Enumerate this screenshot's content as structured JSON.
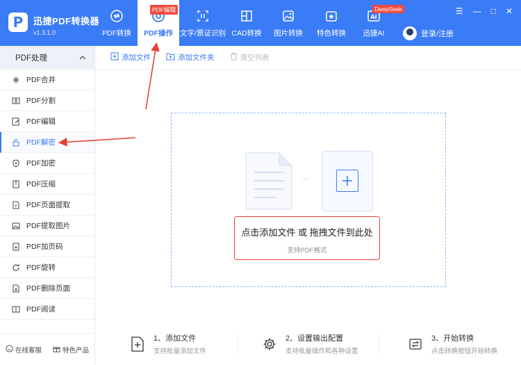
{
  "app": {
    "name": "迅捷PDF转换器",
    "version": "v1.3.1.0",
    "brand_color": "#3a7bf6"
  },
  "nav": [
    {
      "label": "PDF转换",
      "icon": "convert-icon"
    },
    {
      "label": "PDF操作",
      "icon": "pdf-operate-icon",
      "badge": "PDF编辑",
      "active": true
    },
    {
      "label": "文字/票证识别",
      "icon": "ocr-icon"
    },
    {
      "label": "CAD转换",
      "icon": "cad-icon"
    },
    {
      "label": "图片转换",
      "icon": "image-icon"
    },
    {
      "label": "特色转换",
      "icon": "star-icon"
    },
    {
      "label": "迅捷AI",
      "icon": "ai-icon",
      "badge": "DeepSeek"
    }
  ],
  "user": {
    "login_label": "登录/注册"
  },
  "sidebar": {
    "header": "PDF处理",
    "items": [
      {
        "label": "PDF合并",
        "icon": "merge-icon"
      },
      {
        "label": "PDF分割",
        "icon": "split-icon"
      },
      {
        "label": "PDF编辑",
        "icon": "edit-icon"
      },
      {
        "label": "PDF解密",
        "icon": "unlock-icon",
        "active": true
      },
      {
        "label": "PDF加密",
        "icon": "shield-icon"
      },
      {
        "label": "PDF压缩",
        "icon": "compress-icon"
      },
      {
        "label": "PDF页面提取",
        "icon": "extract-page-icon"
      },
      {
        "label": "PDF提取图片",
        "icon": "extract-image-icon"
      },
      {
        "label": "PDF加页码",
        "icon": "page-number-icon"
      },
      {
        "label": "PDF旋转",
        "icon": "rotate-icon"
      },
      {
        "label": "PDF删除页面",
        "icon": "delete-page-icon"
      },
      {
        "label": "PDF阅读",
        "icon": "read-icon"
      }
    ],
    "footer": {
      "service": "在线客服",
      "featured": "特色产品"
    }
  },
  "toolbar": {
    "add_file": "添加文件",
    "add_folder": "添加文件夹",
    "clear_list": "清空列表"
  },
  "dropzone": {
    "main": "点击添加文件 或 拖拽文件到此处",
    "sub": "支持PDF格式"
  },
  "steps": [
    {
      "title": "1、添加文件",
      "desc": "支持批量添加文件"
    },
    {
      "title": "2、设置输出配置",
      "desc": "支持批量操作和各种设置"
    },
    {
      "title": "3、开始转换",
      "desc": "点击转换按钮开始转换"
    }
  ],
  "annotation_color": "#e5423a"
}
